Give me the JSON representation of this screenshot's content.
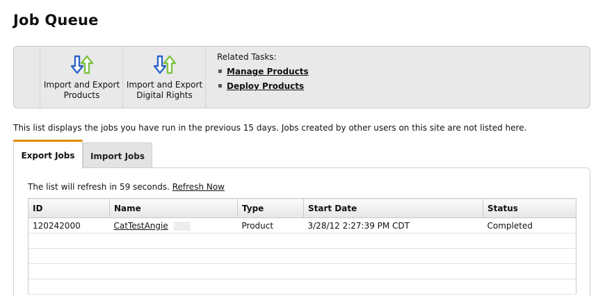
{
  "page": {
    "title": "Job Queue"
  },
  "tasks": {
    "buttons": [
      {
        "label": "Import and Export Products",
        "icon": "import-export-arrows-icon"
      },
      {
        "label": "Import and Export Digital Rights",
        "icon": "import-export-arrows-icon"
      }
    ],
    "related_title": "Related Tasks:",
    "related_links": [
      "Manage Products",
      "Deploy Products"
    ]
  },
  "description": "This list displays the jobs you have run in the previous 15 days. Jobs created by other users on this site are not listed here.",
  "tabs": [
    {
      "label": "Export Jobs",
      "active": true
    },
    {
      "label": "Import Jobs",
      "active": false
    }
  ],
  "refresh": {
    "text": "The list will refresh in 59 seconds.",
    "link": "Refresh Now"
  },
  "table": {
    "columns": [
      "ID",
      "Name",
      "Type",
      "Start Date",
      "Status"
    ],
    "rows": [
      {
        "id": "120242000",
        "name": "CatTestAngie",
        "type": "Product",
        "start_date": "3/28/12 2:27:39 PM CDT",
        "status": "Completed"
      }
    ]
  },
  "colors": {
    "tab_accent": "#e08a00",
    "arrow_blue": "#2b63c6",
    "arrow_green": "#7dc142"
  }
}
